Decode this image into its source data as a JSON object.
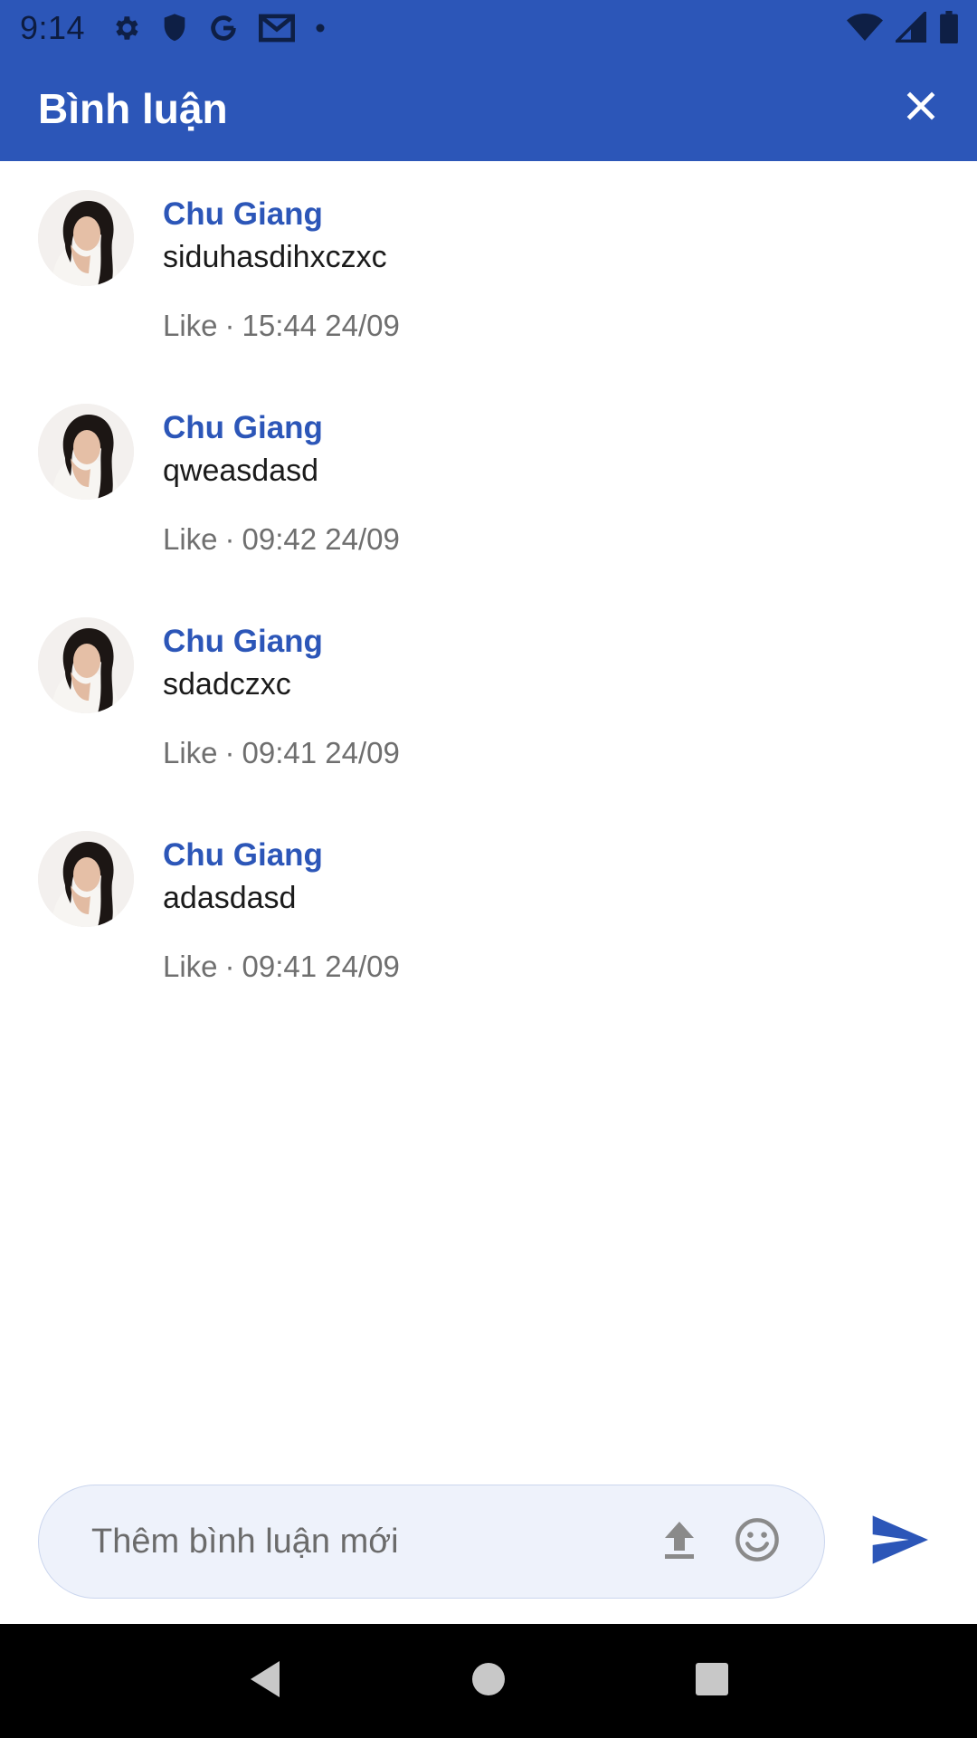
{
  "status_bar": {
    "time": "9:14",
    "icons": [
      "gear-icon",
      "shield-icon",
      "google-icon",
      "gmail-icon",
      "dot-icon",
      "wifi-icon",
      "signal-icon",
      "battery-icon"
    ]
  },
  "app_bar": {
    "title": "Bình luận",
    "close_icon": "close-icon",
    "color": "#2c56b8"
  },
  "comments": [
    {
      "author": "Chu Giang",
      "text": "siduhasdihxczxc",
      "like_label": "Like",
      "separator": "·",
      "time": "15:44 24/09"
    },
    {
      "author": "Chu Giang",
      "text": "qweasdasd",
      "like_label": "Like",
      "separator": "·",
      "time": "09:42 24/09"
    },
    {
      "author": "Chu Giang",
      "text": "sdadczxc",
      "like_label": "Like",
      "separator": "·",
      "time": "09:41 24/09"
    },
    {
      "author": "Chu Giang",
      "text": "adasdasd",
      "like_label": "Like",
      "separator": "·",
      "time": "09:41 24/09"
    }
  ],
  "composer": {
    "placeholder": "Thêm bình luận mới",
    "value": "",
    "upload_icon": "upload-icon",
    "emoji_icon": "emoji-icon",
    "send_icon": "send-icon"
  },
  "nav_bar": {
    "back_icon": "back-icon",
    "home_icon": "home-icon",
    "recents_icon": "recents-icon"
  }
}
